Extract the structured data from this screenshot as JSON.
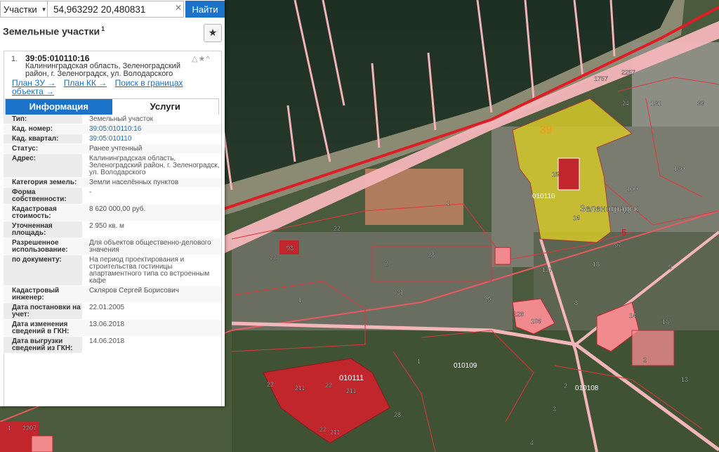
{
  "search": {
    "category": "Участки",
    "query": "54,963292 20,480831",
    "clear_icon": "close-icon",
    "find_label": "Найти"
  },
  "panel": {
    "title": "Земельные участки",
    "title_count": "1",
    "favorite_icon": "star-icon"
  },
  "parcel": {
    "index": "1.",
    "cad_number": "39:05:010110:16",
    "address": "Калининградская область, Зеленоградский район, г. Зеленоградск, ул. Володарского",
    "links": [
      "План ЗУ →",
      "План КК →",
      "Поиск в границах объекта →"
    ],
    "tools": "△★^",
    "tabs": [
      "Информация",
      "Услуги"
    ],
    "properties": [
      {
        "key": "Тип:",
        "value": "Земельный участок"
      },
      {
        "key": "Кад. номер:",
        "value": "39:05:010110:16",
        "link": true
      },
      {
        "key": "Кад. квартал:",
        "value": "39:05:010110",
        "link": true
      },
      {
        "key": "Статус:",
        "value": "Ранее учтенный"
      },
      {
        "key": "Адрес:",
        "value": "Калининградская область, Зеленоградский район, г. Зеленоградск, ул. Володарского"
      },
      {
        "key": "Категория земель:",
        "value": "Земли населённых пунктов"
      },
      {
        "key": "Форма собственности:",
        "value": "-"
      },
      {
        "key": "Кадастровая стоимость:",
        "value": "8 620 000,00 руб."
      },
      {
        "key": "Уточненная площадь:",
        "value": "2 950 кв. м"
      },
      {
        "key": "Разрешенное использование:",
        "value": "Для объектов общественно-делового значения"
      },
      {
        "key": "по документу:",
        "value": "На период проектирования и строительства гостиницы апартаментного типа со встроенным кафе"
      },
      {
        "key": "Кадастровый инженер:",
        "value": "Скляров Сергей Борисович"
      },
      {
        "key": "Дата постановки на учет:",
        "value": "22.01.2005"
      },
      {
        "key": "Дата изменения сведений в ГКН:",
        "value": "13.06.2018"
      },
      {
        "key": "Дата выгрузки сведений из ГКН:",
        "value": "14.06.2018"
      }
    ]
  },
  "map": {
    "city_label": "Зеленоградск",
    "highlight_label": "39",
    "quarter_labels": [
      "010110",
      "010109",
      "010108",
      "010111"
    ],
    "parcel_labels": [
      "1757",
      "2257",
      "24",
      "131",
      "33",
      "130",
      "100",
      "15",
      "16",
      "5",
      "97",
      "9",
      "18",
      "127",
      "8",
      "128",
      "106",
      "14",
      "16",
      "2",
      "13",
      "1",
      "22",
      "28",
      "2",
      "31",
      "29",
      "1",
      "22",
      "93",
      "22",
      "211",
      "211",
      "211",
      "22",
      "28",
      "2207",
      "2",
      "4",
      "3",
      "23",
      "22",
      "1"
    ],
    "colors": {
      "sea": "#1f3324",
      "highlight": "#d4c82a",
      "parcel_fill": "#c0262c",
      "parcel_light": "#f08a8f",
      "road": "#f4b6ba",
      "boundary": "#e01c24",
      "accent": "#1a73c8"
    }
  }
}
